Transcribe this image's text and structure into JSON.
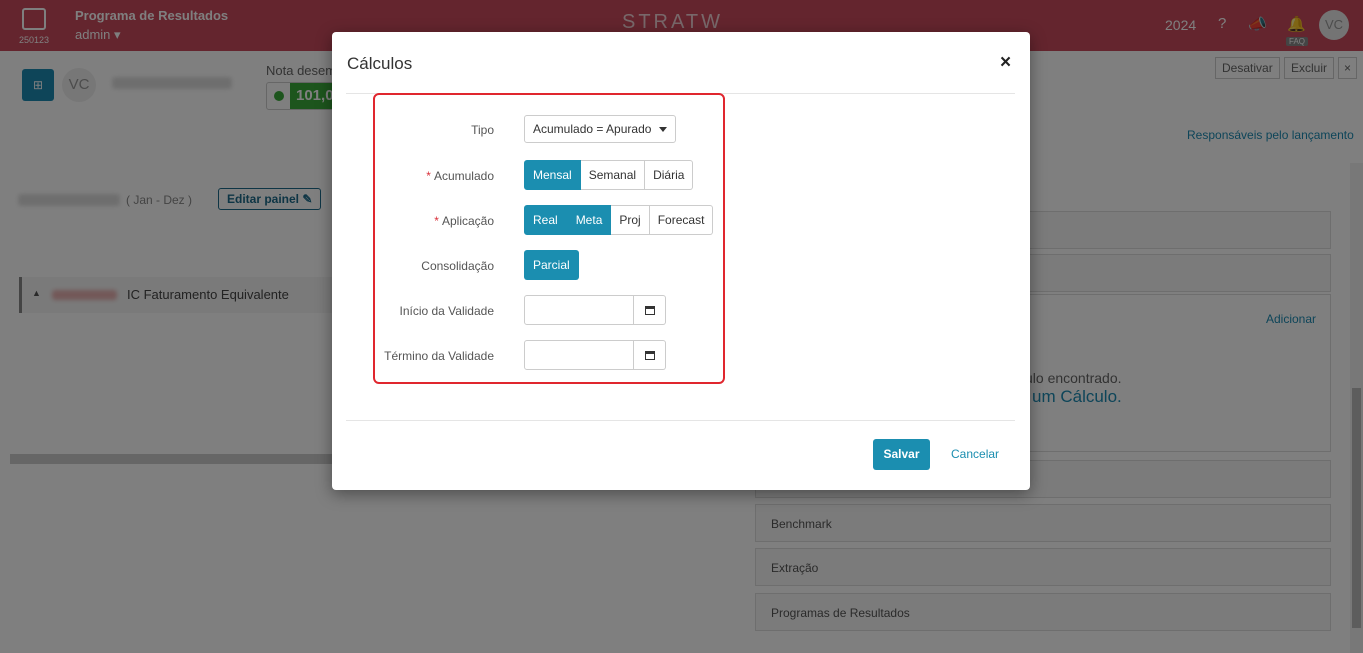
{
  "topbar": {
    "app_version": "250123",
    "program_name": "Programa de Resultados",
    "user": "admin",
    "brand": "STRATW",
    "year": "2024",
    "avatar": "VC",
    "faq": "FAQ"
  },
  "background": {
    "avatar": "VC",
    "nota_label": "Nota desem",
    "score": "101,0",
    "deactivate_label": "Desativar",
    "delete_label": "Excluir",
    "close_label": "×",
    "responsaveis_link": "Responsáveis pelo lançamento",
    "period": "( Jan - Dez )",
    "edit_panel_label": "Editar painel ✎",
    "row_text": "IC  Faturamento Equivalente",
    "adicionar_link": "Adicionar",
    "empty_line1": "culo encontrado.",
    "empty_line2": "um Cálculo.",
    "panels": [
      "Benchmark",
      "Extração",
      "Programas de Resultados"
    ]
  },
  "modal": {
    "title": "Cálculos",
    "close": "×",
    "fields": {
      "tipo": {
        "label": "Tipo",
        "value": "Acumulado = Apurado"
      },
      "acumulado": {
        "label": "Acumulado",
        "required": "*",
        "options": [
          "Mensal",
          "Semanal",
          "Diária"
        ],
        "selected": [
          "Mensal"
        ]
      },
      "aplicacao": {
        "label": "Aplicação",
        "required": "*",
        "options": [
          "Real",
          "Meta",
          "Proj",
          "Forecast"
        ],
        "selected": [
          "Real",
          "Meta"
        ]
      },
      "consolidacao": {
        "label": "Consolidação",
        "value": "Parcial"
      },
      "inicio": {
        "label": "Início da Validade",
        "value": ""
      },
      "termino": {
        "label": "Término da Validade",
        "value": ""
      }
    },
    "save_label": "Salvar",
    "cancel_label": "Cancelar"
  },
  "colors": {
    "primary": "#1b8eb0",
    "topbar": "#c84a5c",
    "highlight": "#e0262e"
  }
}
